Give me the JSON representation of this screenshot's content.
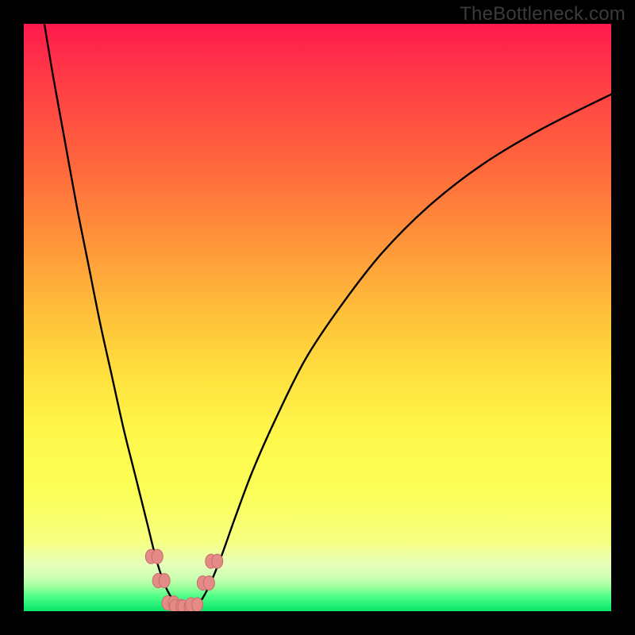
{
  "watermark": "TheBottleneck.com",
  "chart_data": {
    "type": "line",
    "title": "",
    "xlabel": "",
    "ylabel": "",
    "xlim": [
      0,
      100
    ],
    "ylim": [
      0,
      100
    ],
    "grid": false,
    "series": [
      {
        "name": "bottleneck-curve",
        "x": [
          3.5,
          5,
          7,
          9,
          11,
          13,
          15,
          17,
          19,
          21,
          22.5,
          24,
          25.5,
          27,
          28.5,
          30,
          31.5,
          33.5,
          36,
          39,
          43,
          48,
          54,
          61,
          69,
          78,
          88,
          100
        ],
        "y": [
          100,
          91,
          80,
          69,
          59,
          49,
          40,
          31,
          23,
          15,
          9,
          4.5,
          1.8,
          0.7,
          0.7,
          1.6,
          4.2,
          9,
          16,
          24,
          33,
          43,
          52,
          61,
          69,
          76,
          82,
          88
        ]
      }
    ],
    "markers": [
      {
        "name": "left-upper",
        "x": 22.2,
        "y": 9.3
      },
      {
        "name": "left-mid",
        "x": 23.4,
        "y": 5.2
      },
      {
        "name": "flat-1",
        "x": 25.0,
        "y": 1.4
      },
      {
        "name": "flat-2",
        "x": 26.3,
        "y": 0.8
      },
      {
        "name": "flat-3",
        "x": 27.7,
        "y": 0.7
      },
      {
        "name": "flat-4",
        "x": 29.0,
        "y": 1.1
      },
      {
        "name": "right-mid",
        "x": 31.0,
        "y": 4.8
      },
      {
        "name": "right-upper",
        "x": 32.4,
        "y": 8.5
      }
    ],
    "background_gradient": {
      "top": "#ff1a4d",
      "middle": "#fff84c",
      "bottom": "#08e46a"
    }
  }
}
